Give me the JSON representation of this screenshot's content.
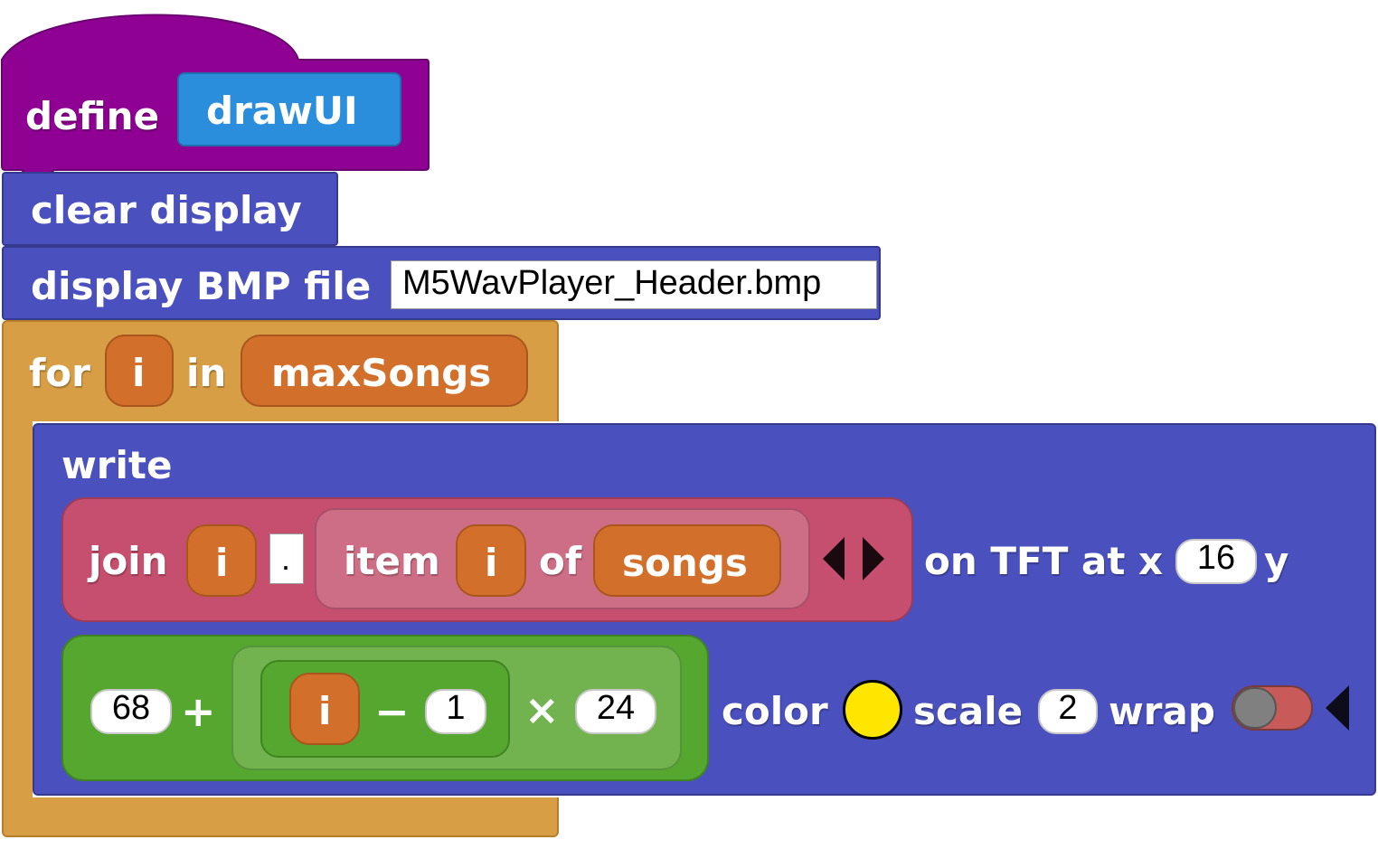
{
  "define_block": {
    "keyword": "define",
    "name": "drawUI"
  },
  "clear_block": {
    "label": "clear display"
  },
  "bmp_block": {
    "label": "display BMP file",
    "filename": "M5WavPlayer_Header.bmp"
  },
  "for_block": {
    "keyword": "for",
    "var": "i",
    "in": "in",
    "collection": "maxSongs"
  },
  "write_block": {
    "label": "write",
    "join": {
      "label": "join",
      "first": "i",
      "separator": ".",
      "item_label": "item",
      "item_index": "i",
      "of": "of",
      "list": "songs"
    },
    "on_tft": "on TFT at x",
    "x_value": "16",
    "y_label": "y",
    "y_expr": {
      "base": "68",
      "plus": "+",
      "var": "i",
      "minus": "−",
      "one": "1",
      "times": "×",
      "step": "24"
    },
    "color_label": "color",
    "color_value": "#FFE600",
    "scale_label": "scale",
    "scale_value": "2",
    "wrap_label": "wrap",
    "wrap_on": false
  },
  "icons": [
    "arrows-left-right-icon",
    "collapse-left-icon",
    "toggle-switch-icon"
  ]
}
